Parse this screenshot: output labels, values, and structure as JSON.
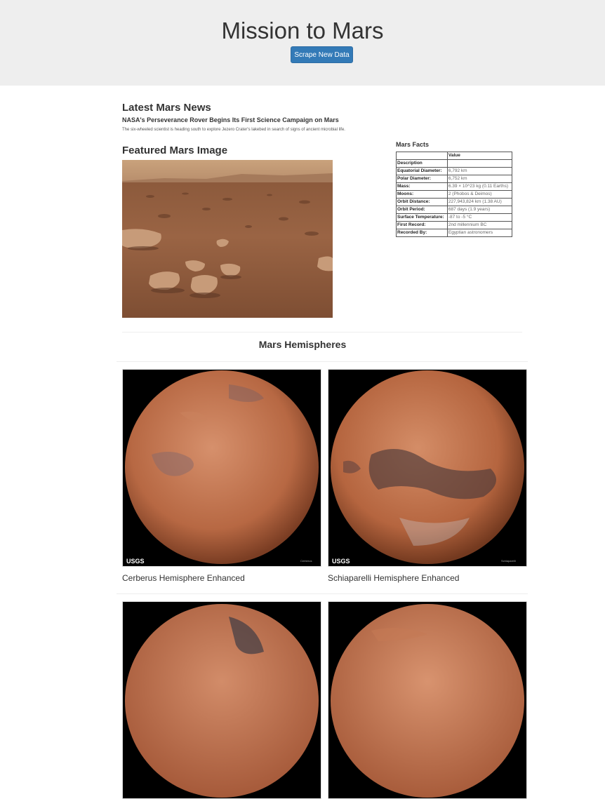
{
  "header": {
    "title": "Mission to Mars",
    "scrape_button": "Scrape New Data"
  },
  "news": {
    "heading": "Latest Mars News",
    "title": "NASA's Perseverance Rover Begins Its First Science Campaign on Mars",
    "paragraph": "The six-wheeled scientist is heading south to explore Jezero Crater's lakebed in search of signs of ancient microbial life."
  },
  "featured": {
    "heading": "Featured Mars Image"
  },
  "facts": {
    "heading": "Mars Facts",
    "col_header": "Value",
    "index_label": "Description",
    "rows": [
      {
        "label": "Equatorial Diameter:",
        "value": "6,792 km"
      },
      {
        "label": "Polar Diameter:",
        "value": "6,752 km"
      },
      {
        "label": "Mass:",
        "value": "6.39 × 10^23 kg (0.11 Earths)"
      },
      {
        "label": "Moons:",
        "value": "2 (Phobos & Deimos)"
      },
      {
        "label": "Orbit Distance:",
        "value": "227,943,824 km (1.38 AU)"
      },
      {
        "label": "Orbit Period:",
        "value": "687 days (1.9 years)"
      },
      {
        "label": "Surface Temperature:",
        "value": "-87 to -5 °C"
      },
      {
        "label": "First Record:",
        "value": "2nd millennium BC"
      },
      {
        "label": "Recorded By:",
        "value": "Egyptian astronomers"
      }
    ]
  },
  "hemispheres": {
    "heading": "Mars Hemispheres",
    "items": [
      {
        "title": "Cerberus Hemisphere Enhanced",
        "logo": "USGS",
        "corner_label": "Cerberus"
      },
      {
        "title": "Schiaparelli Hemisphere Enhanced",
        "logo": "USGS",
        "corner_label": "Schiaparelli"
      },
      {
        "title": "",
        "logo": "",
        "corner_label": ""
      },
      {
        "title": "",
        "logo": "",
        "corner_label": ""
      }
    ]
  },
  "colors": {
    "jumbotron_bg": "#eeeeee",
    "button_bg": "#337ab7",
    "mars_orange": "#b8613f"
  }
}
